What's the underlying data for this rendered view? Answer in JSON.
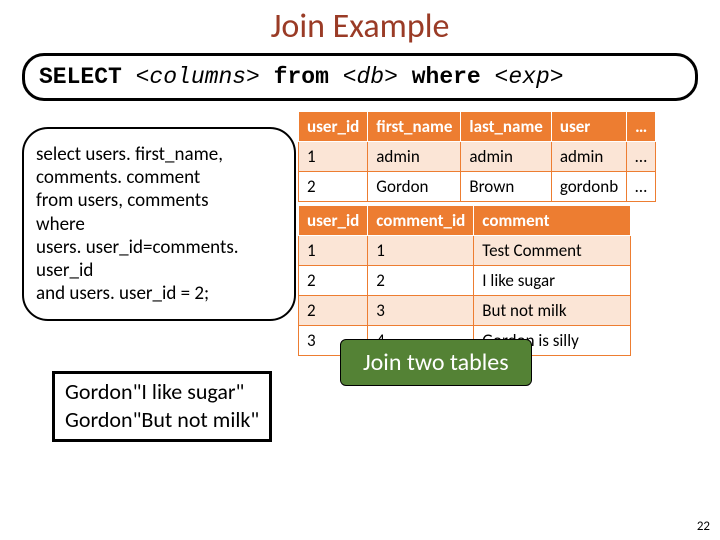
{
  "title": "Join Example",
  "sql_syntax": {
    "kw1": "SELECT ",
    "ph1": "<columns>",
    "kw2": " from ",
    "ph2": "<db>",
    "kw3": " where ",
    "ph3": "<exp>"
  },
  "query_lines": {
    "l1": "select users. first_name,",
    "l2": "comments. comment",
    "l3": "from users, comments",
    "l4": "where",
    "l5": "users. user_id=comments.",
    "l6": "user_id",
    "l7": "and users. user_id = 2;"
  },
  "users_table": {
    "headers": {
      "h1": "user_id",
      "h2": "first_name",
      "h3": "last_name",
      "h4": "user",
      "h5": "…"
    },
    "rows": [
      {
        "c1": "1",
        "c2": "admin",
        "c3": "admin",
        "c4": "admin",
        "c5": "…"
      },
      {
        "c1": "2",
        "c2": "Gordon",
        "c3": "Brown",
        "c4": "gordonb",
        "c5": "…"
      }
    ]
  },
  "comments_table": {
    "headers": {
      "h1": "user_id",
      "h2": "comment_id",
      "h3": "comment"
    },
    "rows": [
      {
        "c1": "1",
        "c2": "1",
        "c3": "Test Comment"
      },
      {
        "c1": "2",
        "c2": "2",
        "c3": "I like sugar"
      },
      {
        "c1": "2",
        "c2": "3",
        "c3": "But not milk"
      },
      {
        "c1": "3",
        "c2": "4",
        "c3": "Gordon is silly"
      }
    ]
  },
  "callout": "Join two tables",
  "result": {
    "l1": "Gordon\"I like sugar\"",
    "l2": "Gordon\"But not milk\""
  },
  "page_number": "22",
  "chart_data": {
    "type": "table",
    "tables": [
      {
        "name": "users",
        "columns": [
          "user_id",
          "first_name",
          "last_name",
          "user",
          "…"
        ],
        "rows": [
          [
            1,
            "admin",
            "admin",
            "admin",
            "…"
          ],
          [
            2,
            "Gordon",
            "Brown",
            "gordonb",
            "…"
          ]
        ]
      },
      {
        "name": "comments",
        "columns": [
          "user_id",
          "comment_id",
          "comment"
        ],
        "rows": [
          [
            1,
            1,
            "Test Comment"
          ],
          [
            2,
            2,
            "I like sugar"
          ],
          [
            2,
            3,
            "But not milk"
          ],
          [
            3,
            4,
            "Gordon is silly"
          ]
        ]
      }
    ],
    "join_result": [
      [
        "Gordon",
        "I like sugar"
      ],
      [
        "Gordon",
        "But not milk"
      ]
    ]
  }
}
